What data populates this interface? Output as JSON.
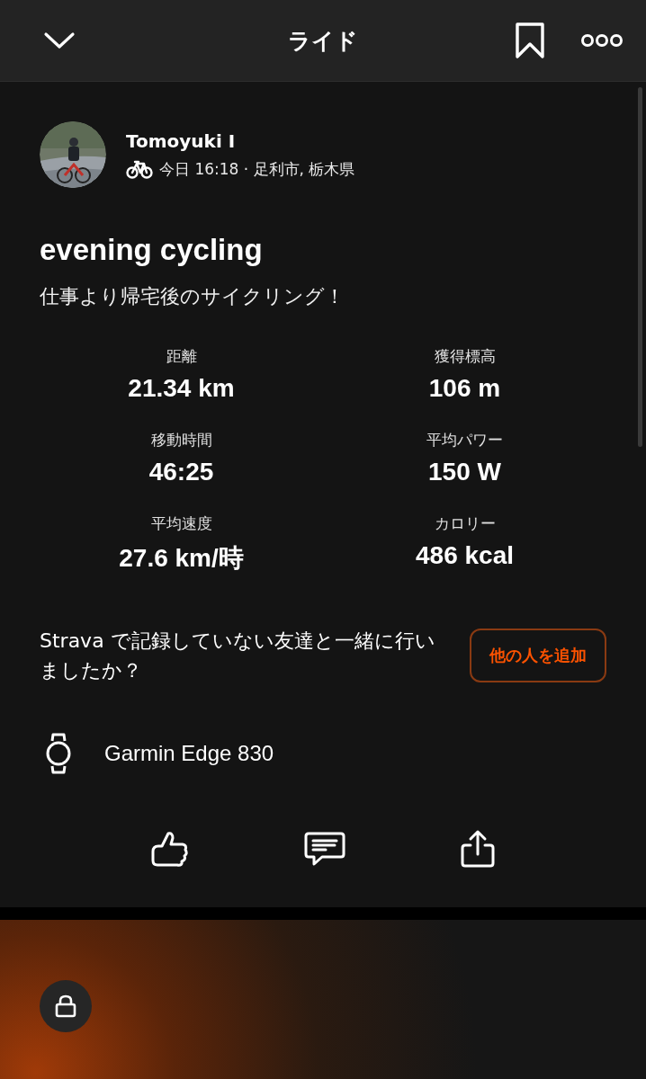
{
  "header": {
    "title": "ライド"
  },
  "athlete": {
    "name": "Tomoyuki I",
    "meta": "今日 16:18 · 足利市, 栃木県"
  },
  "activity": {
    "title": "evening cycling",
    "description": "仕事より帰宅後のサイクリング！"
  },
  "stats": [
    {
      "label": "距離",
      "value": "21.34 km"
    },
    {
      "label": "獲得標高",
      "value": "106 m"
    },
    {
      "label": "移動時間",
      "value": "46:25"
    },
    {
      "label": "平均パワー",
      "value": "150 W"
    },
    {
      "label": "平均速度",
      "value": "27.6 km/時"
    },
    {
      "label": "カロリー",
      "value": "486 kcal"
    }
  ],
  "prompt": {
    "text": "Strava で記録していない友達と一緒に行いましたか？",
    "button": "他の人を追加"
  },
  "device": {
    "name": "Garmin Edge 830"
  }
}
